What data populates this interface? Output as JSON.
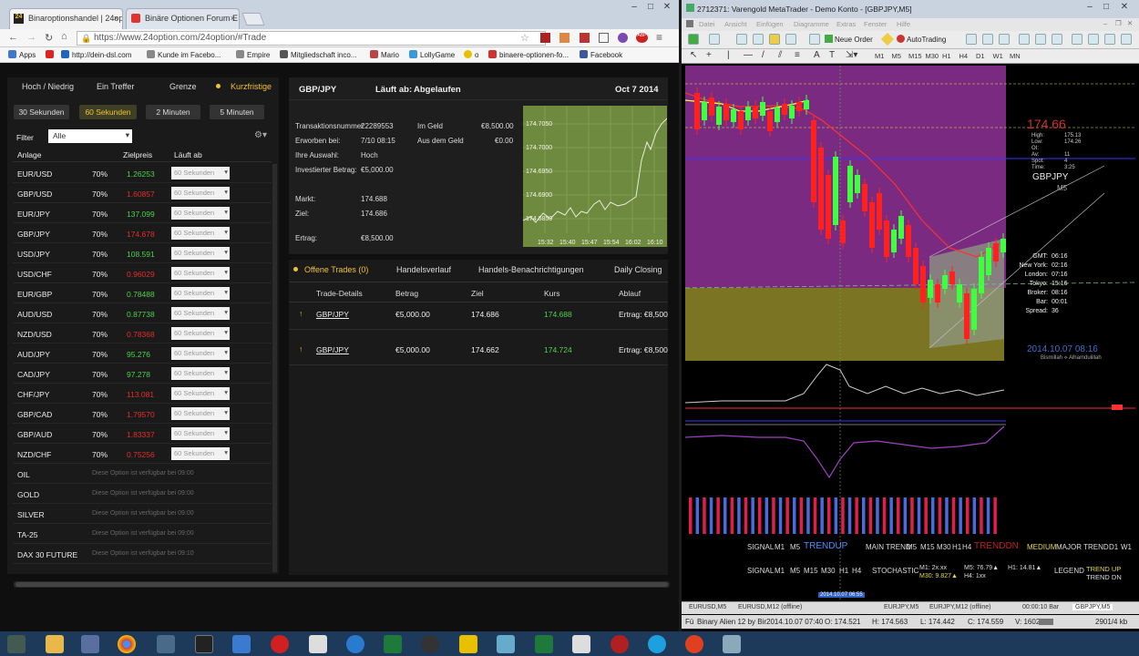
{
  "browser": {
    "tabs": [
      {
        "label": "Binaroptionshandel | 24op",
        "icon": "24option-favicon"
      },
      {
        "label": "Binäre Optionen Forum E",
        "icon": "forum-favicon"
      }
    ],
    "url": "https://www.24option.com/24option/#Trade",
    "bookmarks": [
      "Apps",
      "http://dein-dsl.com",
      "Kunde im Facebo...",
      "Empire",
      "Mitgliedschaft inco...",
      "Mario",
      "LollyGame",
      "o",
      "binaere-optionen-fo...",
      "Facebook"
    ]
  },
  "site": {
    "option_types": [
      "Hoch / Niedrig",
      "Ein Treffer",
      "Grenze",
      "Kurzfristige"
    ],
    "active_type": "Kurzfristige",
    "durations": [
      "30 Sekunden",
      "60 Sekunden",
      "2 Minuten",
      "5 Minuten"
    ],
    "selected_duration": "60 Sekunden",
    "filter_label": "Filter",
    "filter_value": "Alle",
    "col_asset": "Anlage",
    "col_target": "Zielpreis",
    "col_expiry": "Läuft ab",
    "assets": [
      {
        "name": "EUR/USD",
        "pct": "70%",
        "price": "1.26253",
        "dir": "up",
        "expiry": "60 Sekunden"
      },
      {
        "name": "GBP/USD",
        "pct": "70%",
        "price": "1.60857",
        "dir": "down",
        "expiry": "60 Sekunden"
      },
      {
        "name": "EUR/JPY",
        "pct": "70%",
        "price": "137.099",
        "dir": "up",
        "expiry": "60 Sekunden"
      },
      {
        "name": "GBP/JPY",
        "pct": "70%",
        "price": "174.678",
        "dir": "down",
        "expiry": "60 Sekunden"
      },
      {
        "name": "USD/JPY",
        "pct": "70%",
        "price": "108.591",
        "dir": "up",
        "expiry": "60 Sekunden"
      },
      {
        "name": "USD/CHF",
        "pct": "70%",
        "price": "0.96029",
        "dir": "down",
        "expiry": "60 Sekunden"
      },
      {
        "name": "EUR/GBP",
        "pct": "70%",
        "price": "0.78488",
        "dir": "up",
        "expiry": "60 Sekunden"
      },
      {
        "name": "AUD/USD",
        "pct": "70%",
        "price": "0.87738",
        "dir": "up",
        "expiry": "60 Sekunden"
      },
      {
        "name": "NZD/USD",
        "pct": "70%",
        "price": "0.78368",
        "dir": "down",
        "expiry": "60 Sekunden"
      },
      {
        "name": "AUD/JPY",
        "pct": "70%",
        "price": "95.276",
        "dir": "up",
        "expiry": "60 Sekunden"
      },
      {
        "name": "CAD/JPY",
        "pct": "70%",
        "price": "97.278",
        "dir": "up",
        "expiry": "60 Sekunden"
      },
      {
        "name": "CHF/JPY",
        "pct": "70%",
        "price": "113.081",
        "dir": "down",
        "expiry": "60 Sekunden"
      },
      {
        "name": "GBP/CAD",
        "pct": "70%",
        "price": "1.79570",
        "dir": "down",
        "expiry": "60 Sekunden"
      },
      {
        "name": "GBP/AUD",
        "pct": "70%",
        "price": "1.83337",
        "dir": "down",
        "expiry": "60 Sekunden"
      },
      {
        "name": "NZD/CHF",
        "pct": "70%",
        "price": "0.75256",
        "dir": "down",
        "expiry": "60 Sekunden"
      }
    ],
    "unavailable": [
      {
        "name": "OIL",
        "note": "Diese Option ist verfügbar bei 09:00"
      },
      {
        "name": "GOLD",
        "note": "Diese Option ist verfügbar bei 09:00"
      },
      {
        "name": "SILVER",
        "note": "Diese Option ist verfügbar bei 09:00"
      },
      {
        "name": "TA-25",
        "note": "Diese Option ist verfügbar bei 09:00"
      },
      {
        "name": "DAX 30 FUTURE",
        "note": "Diese Option ist verfügbar bei 09:10"
      }
    ],
    "trade": {
      "pair": "GBP/JPY",
      "status_label": "Läuft ab:",
      "status": "Abgelaufen",
      "date": "Oct 7 2014",
      "tx_label": "Transaktionsnummer",
      "tx": "22289553",
      "bought_label": "Erworben bei:",
      "bought": "7/10 08:15",
      "choice_label": "Ihre Auswahl:",
      "choice": "Hoch",
      "invest_label": "Investierter Betrag:",
      "invest": "€5,000.00",
      "inmoney_label": "Im Geld",
      "inmoney": "€8,500.00",
      "outmoney_label": "Aus dem Geld",
      "outmoney": "€0.00",
      "market_label": "Markt:",
      "market": "174.688",
      "target_label": "Ziel:",
      "target": "174.686",
      "payout_label": "Ertrag:",
      "payout": "€8,500.00"
    },
    "mini_chart": {
      "yticks": [
        "174.7050",
        "174.7000",
        "174.6950",
        "174.6900",
        "174.6850"
      ],
      "xticks": [
        "15:32",
        "15:40",
        "15:47",
        "15:54",
        "16:02",
        "16:10",
        "16:1"
      ]
    },
    "tabs2": [
      "Offene Trades (0)",
      "Handelsverlauf",
      "Handels-Benachrichtigungen",
      "Daily Closing"
    ],
    "trades_head": [
      "Trade-Details",
      "Betrag",
      "Ziel",
      "Kurs",
      "Ablauf"
    ],
    "trades": [
      {
        "pair": "GBP/JPY",
        "amount": "€5,000.00",
        "target": "174.686",
        "rate": "174.688",
        "payout": "Ertrag: €8,500"
      },
      {
        "pair": "GBP/JPY",
        "amount": "€5,000.00",
        "target": "174.662",
        "rate": "174.724",
        "payout": "Ertrag: €8,500"
      }
    ]
  },
  "mt4": {
    "title": "2712371: Varengold MetaTrader - Demo Konto - [GBPJPY,M5]",
    "menu": [
      "Datei",
      "Ansicht",
      "Einfügen",
      "Diagramme",
      "Extras",
      "Fenster",
      "Hilfe"
    ],
    "new_order": "Neue Order",
    "autotrading": "AutoTrading",
    "timeframes": [
      "M1",
      "M5",
      "M15",
      "M30",
      "H1",
      "H4",
      "D1",
      "W1",
      "MN"
    ],
    "price": "174.66",
    "info": {
      "High:": "175.13",
      "Low:": "174.26",
      "OI:": "",
      "Av:": "11",
      "Spot:": "4",
      "Time:": "3:25"
    },
    "symbol": "GBPJPY",
    "tf": "M5",
    "sessions": [
      [
        "GMT:",
        "06:16"
      ],
      [
        "New York:",
        "02:16"
      ],
      [
        "London:",
        "07:16"
      ],
      [
        "Tokyo:",
        "15:16"
      ],
      [
        "Broker:",
        "08:16"
      ],
      [
        "Bar:",
        "00:01"
      ],
      [
        "Spread:",
        "36"
      ]
    ],
    "stamp": "2014.10.07 08:16",
    "stamp2": "Bismillah ⟡ Alhamdulillah",
    "signal1": {
      "label": "SIGNAL",
      "tfs": [
        "M1",
        "M5"
      ],
      "trend": "TRENDUP",
      "main": "MAIN TREND",
      "main_tfs": [
        "M5",
        "M15",
        "M30",
        "H1",
        "H4"
      ],
      "dn": "TRENDDN",
      "medium": "MEDIUM",
      "major": "MAJOR TREND",
      "major_tfs": [
        "D1",
        "W1"
      ]
    },
    "signal2": {
      "label": "SIGNAL",
      "tfs": [
        "M1",
        "M5",
        "M15",
        "M30",
        "H1",
        "H4"
      ],
      "stoch": "STOCHASTIC",
      "m1": "M1: 2x.xx",
      "m30": "M30: 9.827▲",
      "m5": "M5: 76.79▲",
      "h1": "H1: 14.81▲",
      "h4": "H4: 1xx",
      "legend": "LEGEND",
      "trend": "TREND UP",
      "trend2": "TREND DN"
    },
    "date_tag": "2014.10.07 06:55",
    "tabs": [
      "EURUSD,M5",
      "EURUSD,M12 (offline)",
      "EURJPY,M5",
      "EURJPY,M12 (offline)",
      "GBPJPY,M5"
    ],
    "bars_tag": "00:00:10 Bar",
    "status": {
      "name": "Binary Alien 12 by Bir",
      "time": "2014.10.07 07:40",
      "o": "O: 174.521",
      "h": "H: 174.563",
      "l": "L: 174.442",
      "c": "C: 174.559",
      "v": "V: 1602",
      "kb": "2901/4 kb"
    }
  },
  "colors": {
    "up": "#4fcf4f",
    "down": "#e0302b",
    "accent": "#f1c232"
  }
}
